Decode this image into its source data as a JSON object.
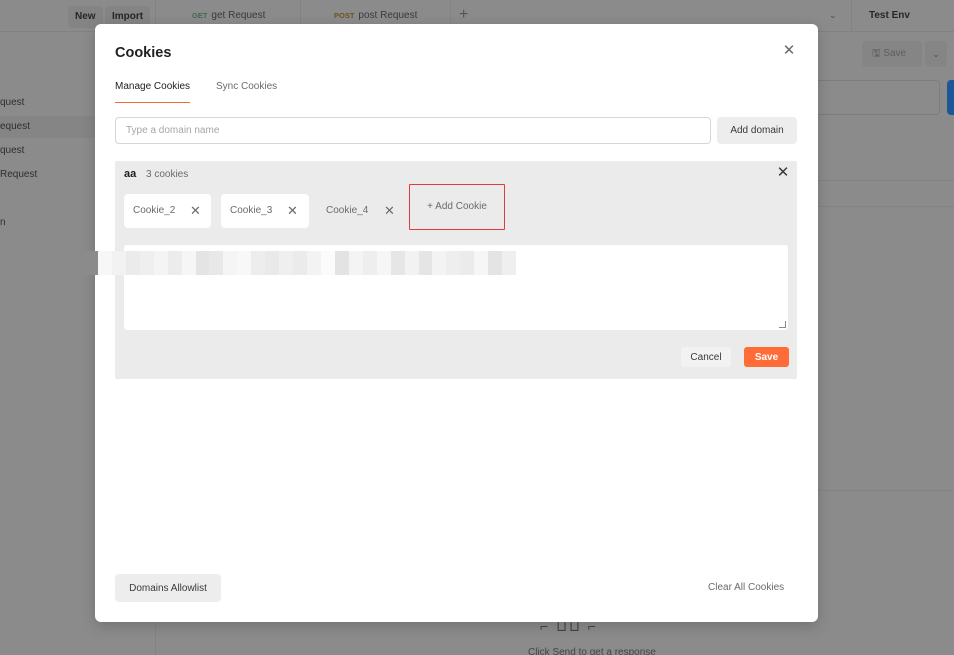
{
  "header": {
    "new_label": "New",
    "import_label": "Import",
    "tabs": [
      {
        "method": "GET",
        "name": "get Request"
      },
      {
        "method": "POST",
        "name": "post Request"
      }
    ],
    "add_tab_icon": "plus-icon",
    "environment": "Test Env"
  },
  "background": {
    "save_label": "Save",
    "sidebar_items": [
      "quest",
      "equest",
      "quest",
      "Request",
      "n"
    ],
    "response_hint": "Click Send to get a response"
  },
  "modal": {
    "title": "Cookies",
    "close_icon": "close-icon",
    "tabs": [
      {
        "label": "Manage Cookies",
        "active": true
      },
      {
        "label": "Sync Cookies",
        "active": false
      }
    ],
    "domain_input": {
      "placeholder": "Type a domain name",
      "value": ""
    },
    "add_domain_label": "Add domain",
    "domain": {
      "name": "aa",
      "count_label": "3 cookies",
      "cookies": [
        "Cookie_2",
        "Cookie_3",
        "Cookie_4"
      ],
      "add_cookie_label": "+ Add Cookie",
      "editor_value": "",
      "cancel_label": "Cancel",
      "save_label": "Save"
    },
    "domains_allowlist_label": "Domains Allowlist",
    "clear_all_label": "Clear All Cookies"
  },
  "colors": {
    "accent": "#ff6c37",
    "tab_underline": "#f26b3a",
    "highlight_box": "#e0393e",
    "overlay": "#8b8b8b"
  }
}
